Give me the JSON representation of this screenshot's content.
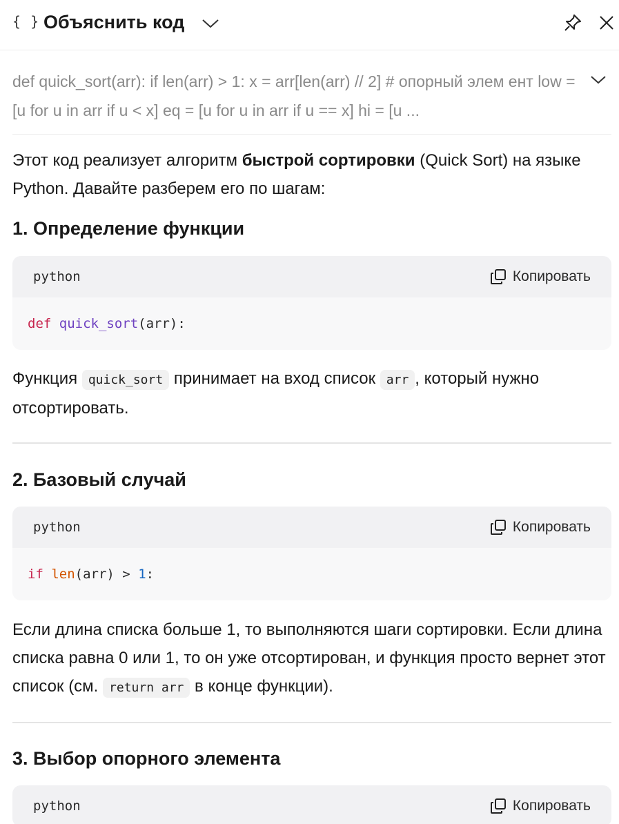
{
  "header": {
    "icon": "braces-icon",
    "braces_text": "{ }",
    "title": "Объяснить код"
  },
  "preview": {
    "text": "def quick_sort(arr): if len(arr) > 1: x = arr[len(arr) // 2] # опорный элем ент low = [u for u in arr if u < x] eq = [u for u in arr if u == x] hi = [u ..."
  },
  "intro": {
    "part1": "Этот код реализует алгоритм ",
    "bold": "быстрой сортировки",
    "part2": " (Quick Sort) на языке Python. Давайте разберем его по шагам:"
  },
  "sections": [
    {
      "heading": "1. Определение функции",
      "code_lang": "python",
      "copy_label": "Копировать",
      "code": {
        "kw": "def",
        "fn": "quick_sort",
        "rest": "(arr):"
      },
      "desc": {
        "t1": "Функция ",
        "c1": "quick_sort",
        "t2": " принимает на вход список ",
        "c2": "arr",
        "t3": ", который нужно отсортировать."
      }
    },
    {
      "heading": "2. Базовый случай",
      "code_lang": "python",
      "copy_label": "Копировать",
      "code": {
        "kw": "if",
        "bi": "len",
        "mid": "(arr) > ",
        "num": "1",
        "end": ":"
      },
      "desc": {
        "t1": "Если длина списка больше 1, то выполняются шаги сортировки. Если длина списка равна 0 или 1, то он уже отсортирован, и функция просто вернет этот список (см. ",
        "c1": "return arr",
        "t2": " в конце функции)."
      }
    },
    {
      "heading": "3. Выбор опорного элемента",
      "code_lang": "python",
      "copy_label": "Копировать"
    }
  ]
}
